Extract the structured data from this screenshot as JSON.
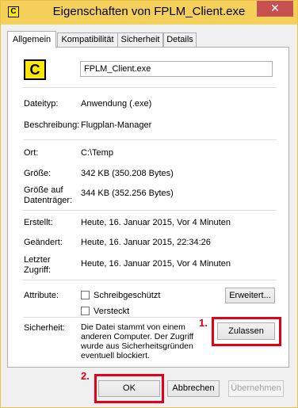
{
  "window": {
    "title": "Eigenschaften von FPLM_Client.exe",
    "title_icon_letter": "C",
    "close_glyph": "✕"
  },
  "tabs": [
    {
      "label": "Allgemein",
      "active": true
    },
    {
      "label": "Kompatibilität",
      "active": false
    },
    {
      "label": "Sicherheit",
      "active": false
    },
    {
      "label": "Details",
      "active": false
    }
  ],
  "general": {
    "icon_letter": "C",
    "filename": "FPLM_Client.exe",
    "rows": {
      "dateityp": {
        "label": "Dateityp:",
        "value": "Anwendung (.exe)"
      },
      "beschreibung": {
        "label": "Beschreibung:",
        "value": "Flugplan-Manager"
      },
      "ort": {
        "label": "Ort:",
        "value": "C:\\Temp"
      },
      "groesse": {
        "label": "Größe:",
        "value": "342 KB (350.208 Bytes)"
      },
      "groesse_datentraeger": {
        "label_line1": "Größe auf",
        "label_line2": "Datenträger:",
        "value": "344 KB (352.256 Bytes)"
      },
      "erstellt": {
        "label": "Erstellt:",
        "value": "Heute, 16. Januar 2015, Vor 4 Minuten"
      },
      "geaendert": {
        "label": "Geändert:",
        "value": "Heute, 16. Januar 2015, 22:34:26"
      },
      "zugriff": {
        "label_line1": "Letzter",
        "label_line2": "Zugriff:",
        "value": "Heute, 16. Januar 2015, Vor 4 Minuten"
      }
    },
    "attributes": {
      "label": "Attribute:",
      "readonly": {
        "label": "Schreibgeschützt",
        "checked": false
      },
      "hidden": {
        "label": "Versteckt",
        "checked": false
      },
      "advanced_button": "Erweitert..."
    },
    "security": {
      "label": "Sicherheit:",
      "text_line1": "Die Datei stammt von einem",
      "text_line2": "anderen Computer. Der Zugriff",
      "text_line3": "wurde aus Sicherheitsgründen",
      "text_line4": "eventuell blockiert.",
      "unblock_button": "Zulassen"
    }
  },
  "footer": {
    "ok": "OK",
    "cancel": "Abbrechen",
    "apply": "Übernehmen"
  },
  "annotations": {
    "step1": "1.",
    "step2": "2.",
    "color": "#e3001b"
  },
  "colors": {
    "titlebar": "#f4cf5a",
    "close_button": "#c75050",
    "icon_yellow": "#ffe800"
  }
}
